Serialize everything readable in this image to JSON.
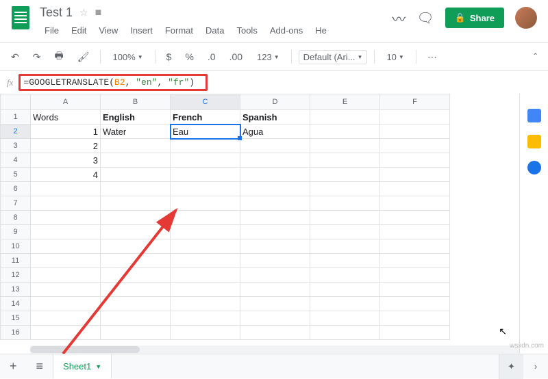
{
  "doc": {
    "title": "Test 1"
  },
  "menus": {
    "file": "File",
    "edit": "Edit",
    "view": "View",
    "insert": "Insert",
    "format": "Format",
    "data": "Data",
    "tools": "Tools",
    "addons": "Add-ons",
    "help": "He"
  },
  "share": {
    "label": "Share"
  },
  "toolbar": {
    "zoom": "100%",
    "currency": "$",
    "percent": "%",
    "dec_dec": ".0",
    "dec_inc": ".00",
    "format": "123",
    "font": "Default (Ari...",
    "size": "10"
  },
  "formula": {
    "prefix": "=GOOGLETRANSLATE(",
    "ref": "B2",
    "mid": ", ",
    "s1": "\"en\"",
    "mid2": ", ",
    "s2": "\"fr\"",
    "suffix": ")"
  },
  "cols": [
    "A",
    "B",
    "C",
    "D",
    "E",
    "F"
  ],
  "rows": [
    "1",
    "2",
    "3",
    "4",
    "5",
    "6",
    "7",
    "8",
    "9",
    "10",
    "11",
    "12",
    "13",
    "14",
    "15",
    "16"
  ],
  "cells": {
    "A1": "Words",
    "B1": "English",
    "C1": "French",
    "D1": "Spanish",
    "A2": "1",
    "B2": "Water",
    "C2": "Eau",
    "D2": "Agua",
    "A3": "2",
    "A4": "3",
    "A5": "4"
  },
  "sheet_tab": "Sheet1",
  "watermark": "wsxdn.com"
}
